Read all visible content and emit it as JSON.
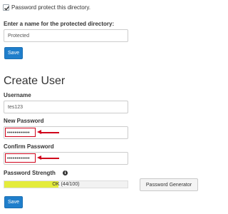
{
  "protect": {
    "checkbox_label": "Password protect this directory.",
    "checked": true
  },
  "protected_dir": {
    "label": "Enter a name for the protected directory:",
    "value": "Protected",
    "save_label": "Save"
  },
  "create_user": {
    "heading": "Create User",
    "username_label": "Username",
    "username_value": "tes123",
    "new_password_label": "New Password",
    "new_password_value": "••••••••••••",
    "confirm_password_label": "Confirm Password",
    "confirm_password_value": "••••••••••••",
    "strength_label": "Password Strength",
    "strength_text": "OK (44/100)",
    "strength_fraction": 0.44,
    "strength_color": "#e4ec3c",
    "generator_label": "Password Generator",
    "save_label": "Save"
  },
  "colors": {
    "primary_button": "#1f7ecb",
    "annotation_red": "#d0021b"
  },
  "icons": {
    "checkbox": "check-icon",
    "info": "info-circle-icon",
    "annotation": "red-arrow-icon"
  }
}
